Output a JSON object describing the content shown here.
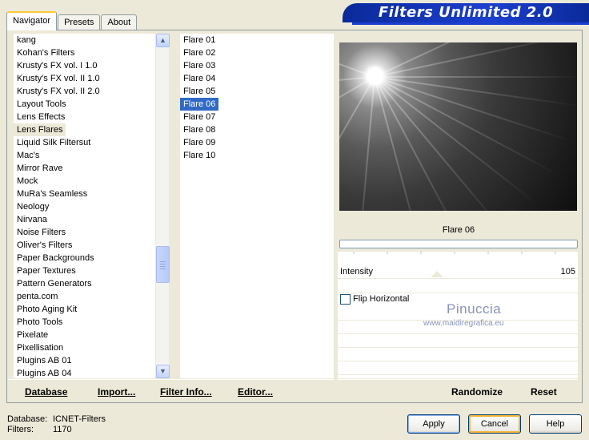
{
  "tabs": [
    "Navigator",
    "Presets",
    "About"
  ],
  "app_title": "Filters Unlimited 2.0",
  "categories": {
    "items": [
      "kang",
      "Kohan's Filters",
      "Krusty's FX vol. I 1.0",
      "Krusty's FX vol. II 1.0",
      "Krusty's FX vol. II 2.0",
      "Layout Tools",
      "Lens Effects",
      "Lens Flares",
      "Liquid Silk Filtersut",
      "Mac's",
      "Mirror Rave",
      "Mock",
      "MuRa's Seamless",
      "Neology",
      "Nirvana",
      "Noise Filters",
      "Oliver's Filters",
      "Paper Backgrounds",
      "Paper Textures",
      "Pattern Generators",
      "penta.com",
      "Photo Aging Kit",
      "Photo Tools",
      "Pixelate",
      "Pixellisation",
      "Plugins AB 01",
      "Plugins AB 04"
    ],
    "selected": "Lens Flares"
  },
  "filters": {
    "items": [
      "Flare 01",
      "Flare 02",
      "Flare 03",
      "Flare 04",
      "Flare 05",
      "Flare 06",
      "Flare 07",
      "Flare 08",
      "Flare 09",
      "Flare 10"
    ],
    "selected": "Flare 06"
  },
  "actions_left": {
    "database": "Database",
    "import": "Import...",
    "filter_info": "Filter Info...",
    "editor": "Editor..."
  },
  "actions_right": {
    "randomize": "Randomize",
    "reset": "Reset"
  },
  "preview": {
    "filter_name": "Flare 06"
  },
  "settings": {
    "intensity_label": "Intensity",
    "intensity_value": "105",
    "flip_label": "Flip Horizontal",
    "flip_checked": false
  },
  "watermark": {
    "line1": "Pinuccia",
    "line2": "www.maidiregrafica.eu"
  },
  "status": {
    "database_key": "Database:",
    "database_value": "ICNET-Filters",
    "filters_key": "Filters:",
    "filters_value": "1170"
  },
  "buttons": {
    "apply": "Apply",
    "cancel": "Cancel",
    "help": "Help"
  },
  "colors": {
    "selection": "#316ac5",
    "banner": "#1c3fcf",
    "window_bg": "#ece9d8"
  }
}
